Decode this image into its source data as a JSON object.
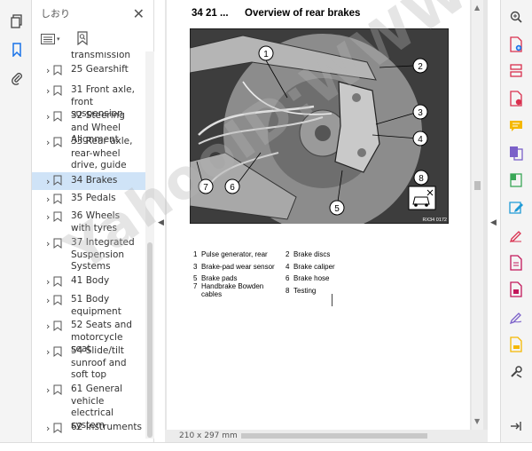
{
  "bookmarks_panel": {
    "title": "しおり",
    "items": [
      {
        "label": "transmission",
        "partial": true
      },
      {
        "label": "25 Gearshift"
      },
      {
        "label": "31 Front axle, front suspension"
      },
      {
        "label": "32 Steering and Wheel Alignment"
      },
      {
        "label": "33 Rear axle, rear-wheel drive, guide"
      },
      {
        "label": "34 Brakes",
        "selected": true
      },
      {
        "label": "35 Pedals"
      },
      {
        "label": "36 Wheels with tyres"
      },
      {
        "label": "37 Integrated Suspension Systems"
      },
      {
        "label": "41 Body"
      },
      {
        "label": "51 Body equipment"
      },
      {
        "label": "52 Seats and motorcycle seat"
      },
      {
        "label": "54 Slide/tilt sunroof and soft top"
      },
      {
        "label": "61 General vehicle electrical system"
      },
      {
        "label": "62 Instruments"
      }
    ]
  },
  "document": {
    "section_number": "34 21 ...",
    "title": "Overview of rear brakes",
    "figure_code": "RX34 0172",
    "callouts": [
      "1",
      "2",
      "3",
      "4",
      "5",
      "6",
      "7",
      "8"
    ],
    "legend": [
      {
        "n": "1",
        "text": "Pulse generator, rear"
      },
      {
        "n": "2",
        "text": "Brake discs"
      },
      {
        "n": "3",
        "text": "Brake-pad wear sensor"
      },
      {
        "n": "4",
        "text": "Brake caliper"
      },
      {
        "n": "5",
        "text": "Brake pads"
      },
      {
        "n": "6",
        "text": "Brake hose"
      },
      {
        "n": "7",
        "text": "Handbrake Bowden cables"
      },
      {
        "n": "8",
        "text": "Testing"
      }
    ]
  },
  "status": {
    "page_size": "210 x 297 mm"
  },
  "watermark": "YahooID:WWW",
  "icons": {
    "left_rail": [
      "pages-icon",
      "bookmark-icon",
      "attachment-icon"
    ],
    "right_rail": [
      "zoom-icon",
      "create-pdf-icon",
      "organize-pages-icon",
      "export-pdf-icon",
      "comment-icon",
      "combine-files-icon",
      "compress-icon",
      "edit-pdf-icon",
      "fill-sign-icon",
      "convert-icon",
      "protect-icon",
      "sign-icon",
      "stamp-icon",
      "more-tools-icon",
      "collapse-panel-icon"
    ]
  },
  "colors": {
    "selected_bookmark": "#cfe3f7",
    "accent": "#1a73e8"
  }
}
